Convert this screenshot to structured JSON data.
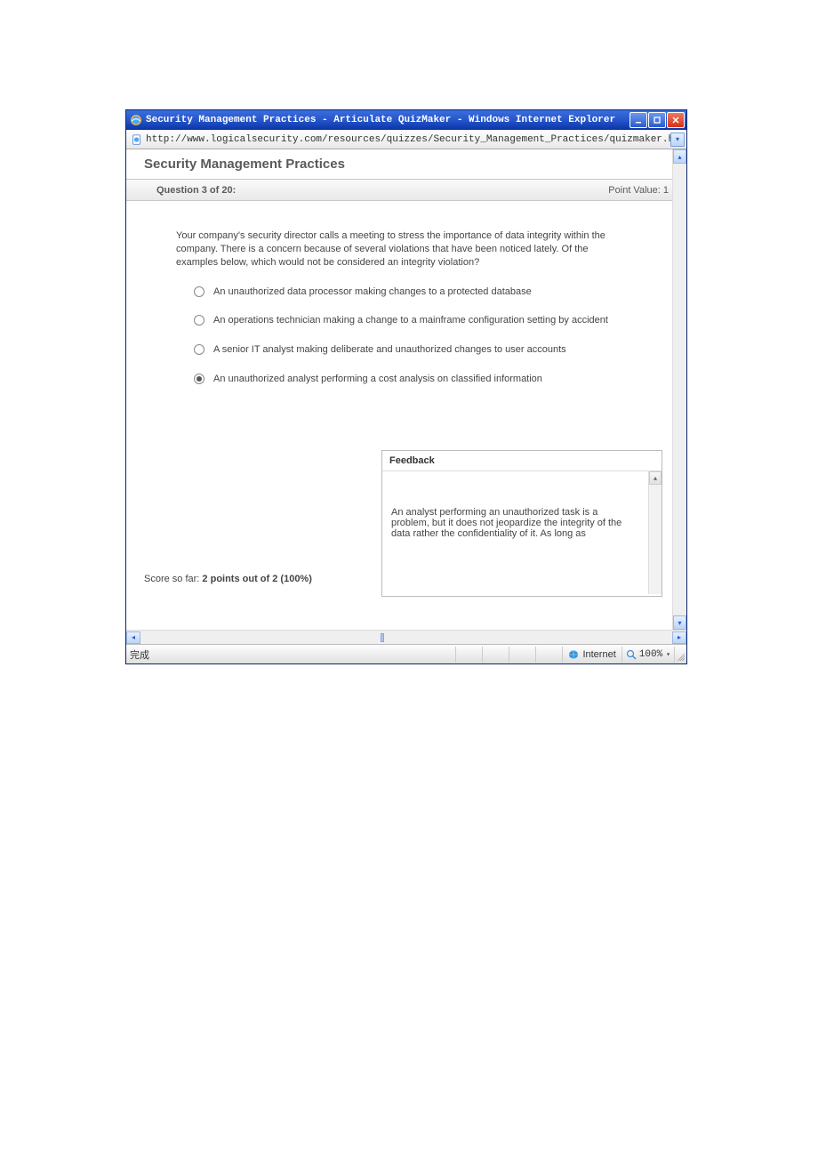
{
  "window": {
    "title": "Security Management Practices - Articulate QuizMaker - Windows Internet Explorer",
    "url": "http://www.logicalsecurity.com/resources/quizzes/Security_Management_Practices/quizmaker.html"
  },
  "quiz": {
    "title": "Security Management Practices",
    "question_header": "Question 3 of 20:",
    "point_label": "Point Value:",
    "point_value": "1",
    "question_text": "Your company's security director calls a meeting to stress the importance of data integrity within the company. There is a concern because of several violations that have been noticed lately. Of the examples below, which would not be considered an integrity violation?",
    "options": [
      "An unauthorized data processor making changes to a protected database",
      "An operations technician making a change to a mainframe configuration setting by accident",
      "A senior IT analyst making deliberate and unauthorized changes to user accounts",
      "An unauthorized analyst performing a cost analysis on classified information"
    ],
    "selected_index": 3,
    "feedback": {
      "title": "Feedback",
      "body": "An analyst performing an unauthorized task is a problem, but it does not jeopardize the integrity of the data rather the confidentiality of it. As long as"
    },
    "score_label": "Score so far:",
    "score_value": "2 points out of 2 (100%)"
  },
  "statusbar": {
    "done": "完成",
    "zone": "Internet",
    "zoom": "100%"
  }
}
